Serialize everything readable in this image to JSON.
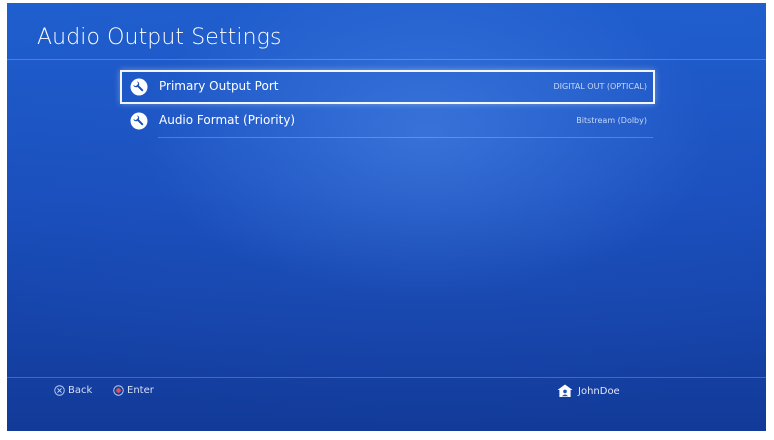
{
  "header": {
    "title": "Audio Output Settings"
  },
  "settings": [
    {
      "label": "Primary Output Port",
      "value": "DIGITAL OUT (OPTICAL)",
      "icon": "wrench-icon",
      "selected": true
    },
    {
      "label": "Audio Format (Priority)",
      "value": "Bitstream (Dolby)",
      "icon": "wrench-icon",
      "selected": false
    }
  ],
  "footer": {
    "back_label": "Back",
    "enter_label": "Enter",
    "username": "JohnDoe"
  },
  "colors": {
    "background_top": "#1f5fcf",
    "background_bottom": "#123a98",
    "selection_border": "#f2f6ff",
    "text": "#ffffff"
  }
}
